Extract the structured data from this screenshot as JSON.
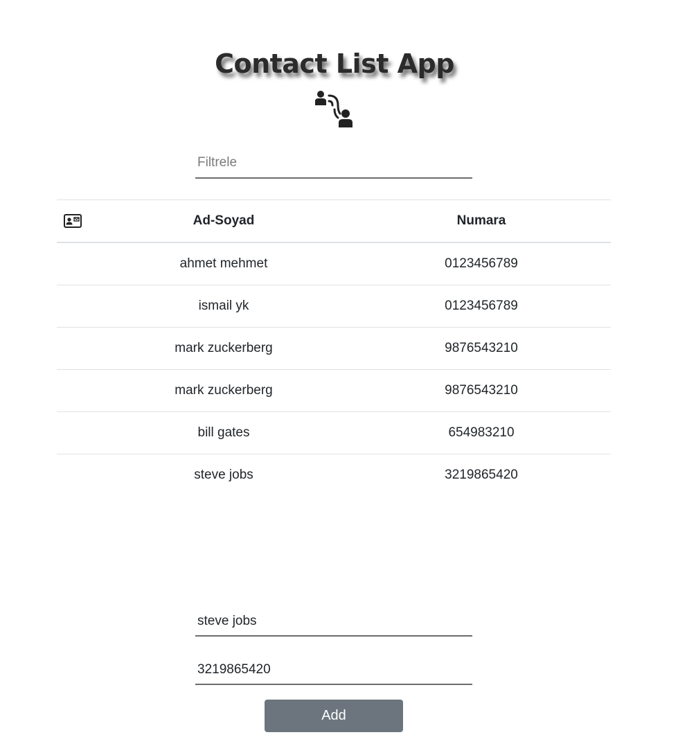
{
  "app": {
    "title": "Contact List App",
    "icon": "contacts-call-icon"
  },
  "filter": {
    "placeholder": "Filtrele",
    "value": ""
  },
  "table": {
    "header_icon": "contact-card-icon",
    "columns": [
      "Ad-Soyad",
      "Numara"
    ],
    "rows": [
      {
        "name": "ahmet mehmet",
        "number": "0123456789"
      },
      {
        "name": "ismail yk",
        "number": "0123456789"
      },
      {
        "name": "mark zuckerberg",
        "number": "9876543210"
      },
      {
        "name": "mark zuckerberg",
        "number": "9876543210"
      },
      {
        "name": "bill gates",
        "number": "654983210"
      },
      {
        "name": "steve jobs",
        "number": "3219865420"
      }
    ]
  },
  "form": {
    "name_value": "steve jobs",
    "number_value": "3219865420",
    "add_label": "Add"
  },
  "colors": {
    "button": "#6c757d",
    "input_border": "#6c6c6c",
    "table_border": "#dee2e6"
  }
}
